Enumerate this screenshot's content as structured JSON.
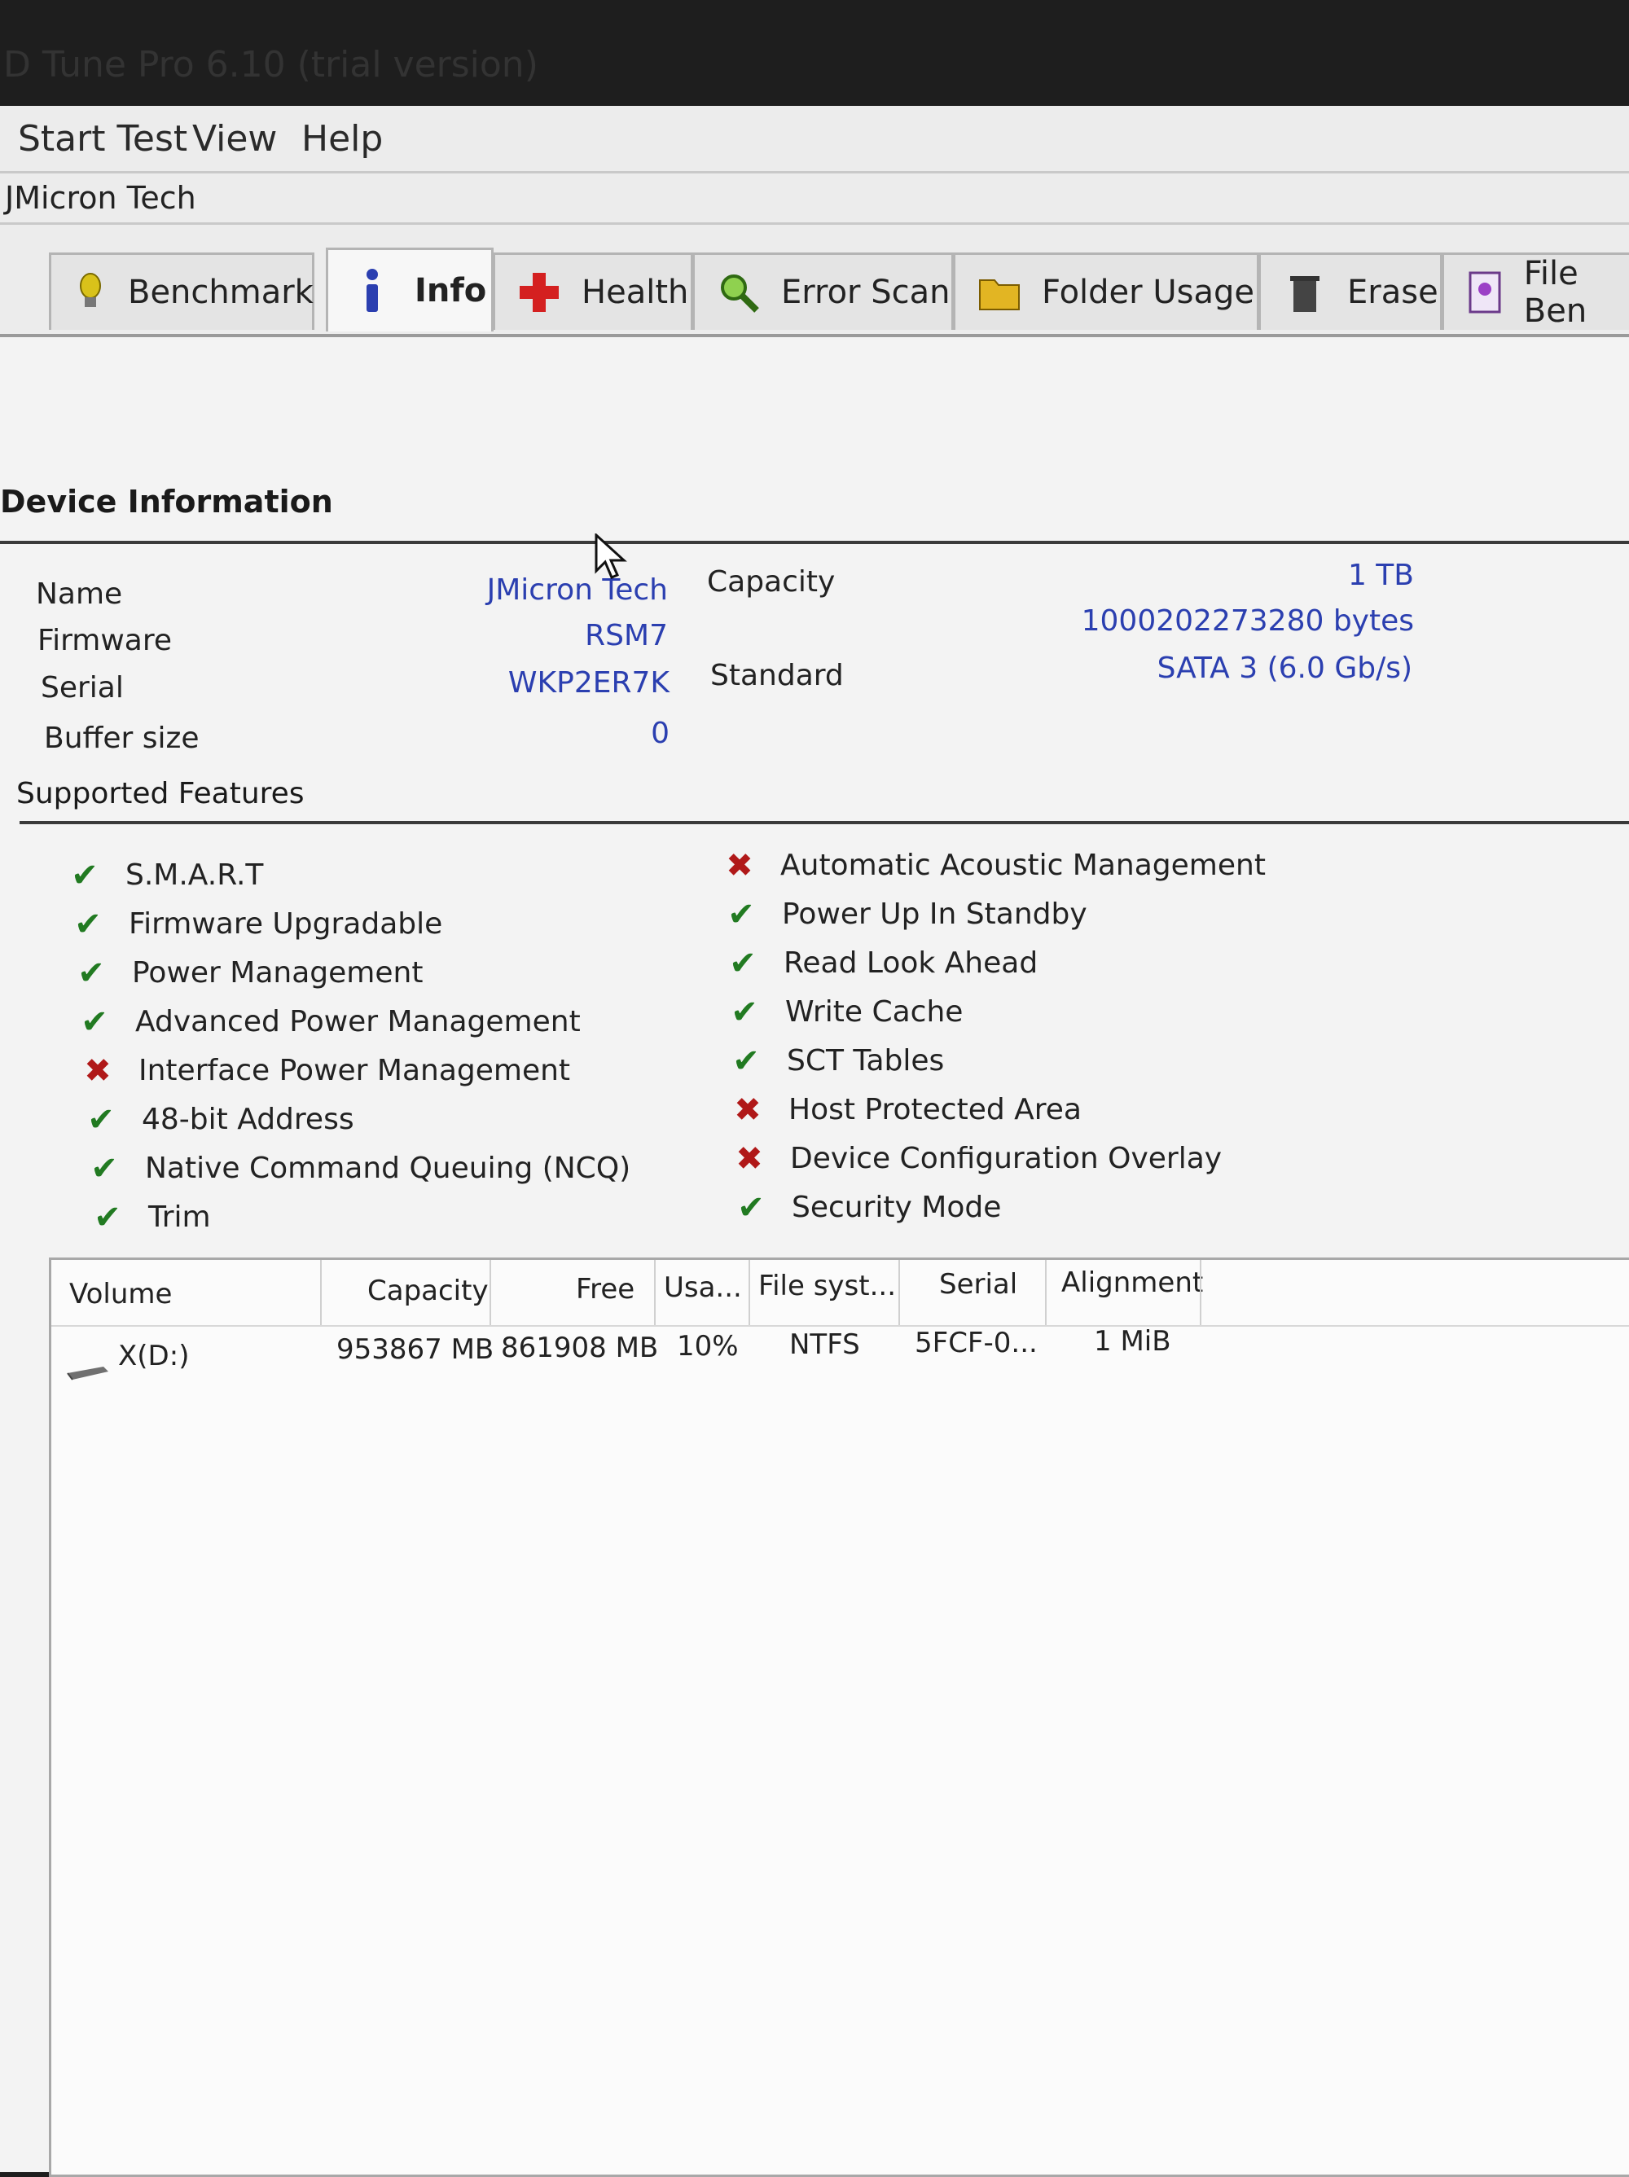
{
  "window": {
    "title": "D Tune Pro 6.10 (trial version)"
  },
  "menu": [
    "Start Test",
    "View",
    "Help"
  ],
  "device_selector": {
    "value": "JMicron Tech"
  },
  "tabs": [
    {
      "label": "Benchmark",
      "icon": "lightbulb-icon"
    },
    {
      "label": "Info",
      "icon": "info-icon"
    },
    {
      "label": "Health",
      "icon": "health-cross-icon"
    },
    {
      "label": "Error Scan",
      "icon": "magnifier-icon"
    },
    {
      "label": "Folder Usage",
      "icon": "folder-icon"
    },
    {
      "label": "Erase",
      "icon": "trash-icon"
    },
    {
      "label": "File Ben",
      "icon": "file-icon"
    }
  ],
  "device_info": {
    "section_title": "Device Information",
    "name_label": "Name",
    "name_value": "JMicron Tech",
    "firmware_label": "Firmware",
    "firmware_value": "RSM7",
    "serial_label": "Serial",
    "serial_value": "WKP2ER7K",
    "buffer_label": "Buffer size",
    "buffer_value": "0",
    "capacity_label": "Capacity",
    "capacity_value": "1 TB",
    "capacity_bytes": "1000202273280 bytes",
    "standard_label": "Standard",
    "standard_value": "SATA 3 (6.0 Gb/s)"
  },
  "supported_features": {
    "section_title": "Supported Features",
    "left": [
      {
        "label": "S.M.A.R.T",
        "supported": true
      },
      {
        "label": "Firmware Upgradable",
        "supported": true
      },
      {
        "label": "Power Management",
        "supported": true
      },
      {
        "label": "Advanced Power Management",
        "supported": true
      },
      {
        "label": "Interface Power Management",
        "supported": false
      },
      {
        "label": "48-bit Address",
        "supported": true
      },
      {
        "label": "Native Command Queuing (NCQ)",
        "supported": true
      },
      {
        "label": "Trim",
        "supported": true
      }
    ],
    "right": [
      {
        "label": "Automatic Acoustic Management",
        "supported": false
      },
      {
        "label": "Power Up In Standby",
        "supported": true
      },
      {
        "label": "Read Look Ahead",
        "supported": true
      },
      {
        "label": "Write Cache",
        "supported": true
      },
      {
        "label": "SCT Tables",
        "supported": true
      },
      {
        "label": "Host Protected Area",
        "supported": false
      },
      {
        "label": "Device Configuration Overlay",
        "supported": false
      },
      {
        "label": "Security Mode",
        "supported": true
      }
    ]
  },
  "volumes": {
    "columns": [
      "Volume",
      "Capacity",
      "Free",
      "Usa...",
      "File syst...",
      "Serial",
      "Alignment"
    ],
    "rows": [
      [
        "X(D:)",
        "953867 MB",
        "861908 MB",
        "10%",
        "NTFS",
        "5FCF-0...",
        "1 MiB"
      ]
    ]
  },
  "colors": {
    "value_text": "#2b3fb0",
    "check": "#217a21",
    "cross": "#b01818"
  }
}
